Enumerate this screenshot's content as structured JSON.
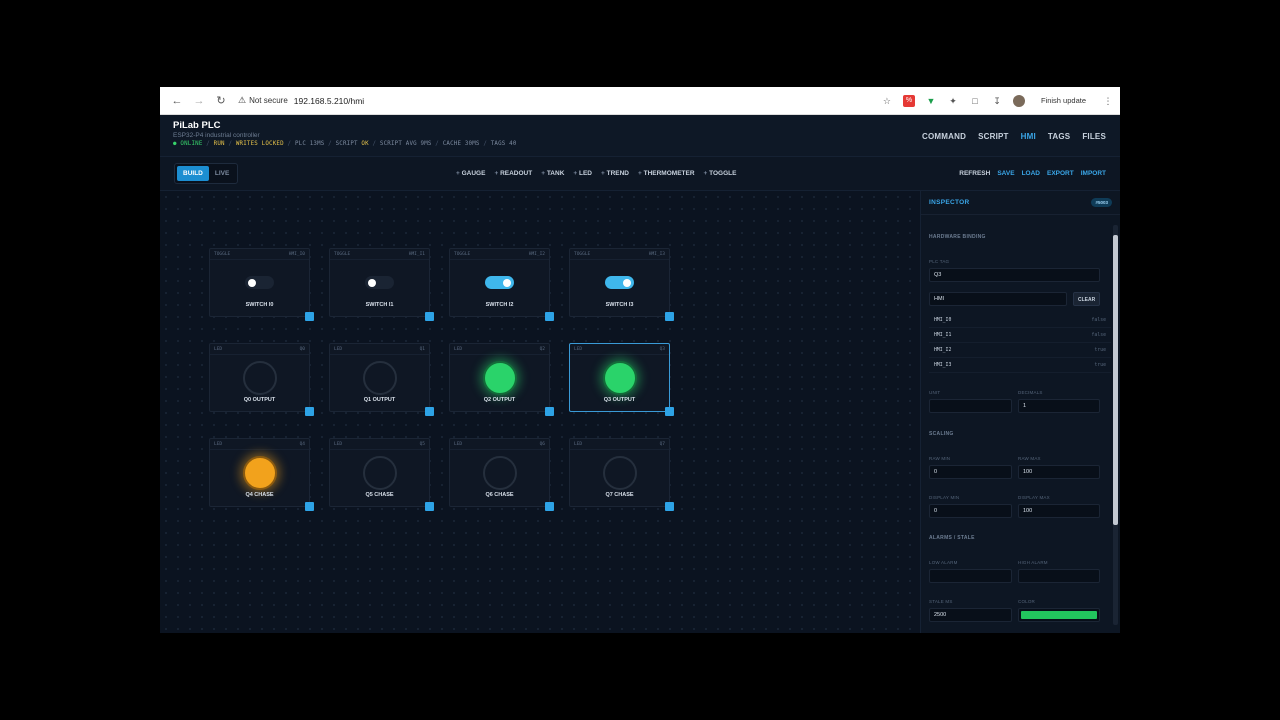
{
  "browser": {
    "security_label": "Not secure",
    "url": "192.168.5.210/hmi",
    "finish_update": "Finish update"
  },
  "app": {
    "title": "PiLab PLC",
    "subtitle": "ESP32-P4 industrial controller",
    "status": {
      "online": "ONLINE",
      "run": "RUN",
      "writes": "WRITES LOCKED",
      "plc": "PLC 13MS",
      "script_label": "SCRIPT",
      "script_state": "OK",
      "script_avg": "SCRIPT AVG 9MS",
      "cache": "CACHE 30MS",
      "tags": "TAGS 40"
    },
    "nav": [
      "COMMAND",
      "SCRIPT",
      "HMI",
      "TAGS",
      "FILES"
    ],
    "nav_active": "HMI"
  },
  "toolbar": {
    "modes": [
      "BUILD",
      "LIVE"
    ],
    "widgets": [
      "GAUGE",
      "READOUT",
      "TANK",
      "LED",
      "TREND",
      "THERMOMETER",
      "TOGGLE"
    ],
    "actions": [
      "REFRESH",
      "SAVE",
      "LOAD",
      "EXPORT",
      "IMPORT"
    ]
  },
  "tiles": {
    "toggles": [
      {
        "kind": "TOGGLE",
        "tag": "HMI_I0",
        "label": "SWITCH I0",
        "on": false
      },
      {
        "kind": "TOGGLE",
        "tag": "HMI_I1",
        "label": "SWITCH I1",
        "on": false
      },
      {
        "kind": "TOGGLE",
        "tag": "HMI_I2",
        "label": "SWITCH I2",
        "on": true
      },
      {
        "kind": "TOGGLE",
        "tag": "HMI_I3",
        "label": "SWITCH I3",
        "on": true
      }
    ],
    "outputs": [
      {
        "kind": "LED",
        "tag": "Q0",
        "label": "Q0 OUTPUT",
        "state": "off"
      },
      {
        "kind": "LED",
        "tag": "Q1",
        "label": "Q1 OUTPUT",
        "state": "off"
      },
      {
        "kind": "LED",
        "tag": "Q2",
        "label": "Q2 OUTPUT",
        "state": "green"
      },
      {
        "kind": "LED",
        "tag": "Q3",
        "label": "Q3 OUTPUT",
        "state": "green"
      }
    ],
    "chase": [
      {
        "kind": "LED",
        "tag": "Q4",
        "label": "Q4 CHASE",
        "state": "amber"
      },
      {
        "kind": "LED",
        "tag": "Q5",
        "label": "Q5 CHASE",
        "state": "off"
      },
      {
        "kind": "LED",
        "tag": "Q6",
        "label": "Q6 CHASE",
        "state": "off"
      },
      {
        "kind": "LED",
        "tag": "Q7",
        "label": "Q7 CHASE",
        "state": "off"
      }
    ]
  },
  "inspector": {
    "title": "INSPECTOR",
    "badge": "#5003",
    "hardware_binding": "HARDWARE BINDING",
    "plc_tag_label": "PLC TAG",
    "plc_tag_value": "Q3",
    "search_value": "HMI",
    "clear": "CLEAR",
    "tag_list": [
      {
        "name": "HMI_I0",
        "value": "false"
      },
      {
        "name": "HMI_I1",
        "value": "false"
      },
      {
        "name": "HMI_I2",
        "value": "true"
      },
      {
        "name": "HMI_I3",
        "value": "true"
      }
    ],
    "unit_label": "UNIT",
    "unit_value": "",
    "decimals_label": "DECIMALS",
    "decimals_value": "1",
    "scaling": "SCALING",
    "raw_min_label": "RAW MIN",
    "raw_min_value": "0",
    "raw_max_label": "RAW MAX",
    "raw_max_value": "100",
    "display_min_label": "DISPLAY MIN",
    "display_min_value": "0",
    "display_max_label": "DISPLAY MAX",
    "display_max_value": "100",
    "alarms": "ALARMS / STALE",
    "low_alarm_label": "LOW ALARM",
    "low_alarm_value": "",
    "high_alarm_label": "HIGH ALARM",
    "high_alarm_value": "",
    "stale_label": "STALE MS",
    "stale_value": "2500",
    "color_label": "COLOR",
    "color_value": "#22c55e"
  }
}
